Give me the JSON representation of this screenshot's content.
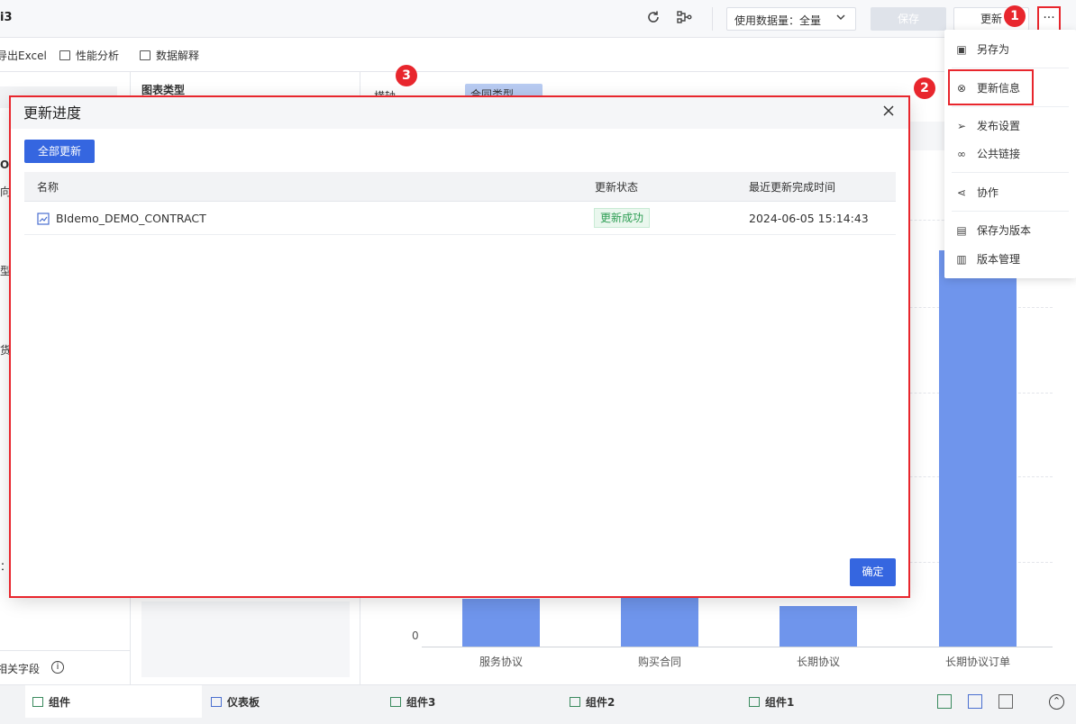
{
  "header": {
    "title": "i3",
    "data_select_label": "使用数据量：全量",
    "save_label": "保存",
    "update_label": "更新",
    "more_label": "···"
  },
  "toolbar": {
    "items": [
      "导出Excel",
      "性能分析",
      "数据解释"
    ]
  },
  "left_panel": {
    "fragments": [
      "O",
      "向",
      "型",
      "货",
      "：",
      "相关字段"
    ]
  },
  "mid_panel": {
    "title": "图表类型"
  },
  "chart_header": {
    "axis_label": "横轴",
    "field_chip": "合同类型"
  },
  "chart_data": {
    "type": "bar",
    "categories": [
      "服务协议",
      "购买合同",
      "长期协议",
      "长期协议订单"
    ],
    "values": [
      3.3,
      8.0,
      2.8,
      37.0
    ],
    "ytick_labels": [
      "0"
    ],
    "ylim": [
      0,
      40
    ],
    "bar_color": "#6f95ec"
  },
  "menu": {
    "items": [
      "另存为",
      "更新信息",
      "发布设置",
      "公共链接",
      "协作",
      "保存为版本",
      "版本管理"
    ],
    "highlighted": "更新信息"
  },
  "annotations": {
    "badges": [
      "1",
      "2",
      "3"
    ]
  },
  "dialog": {
    "title": "更新进度",
    "update_all_label": "全部更新",
    "columns": [
      "名称",
      "更新状态",
      "最近更新完成时间"
    ],
    "rows": [
      {
        "name": "BIdemo_DEMO_CONTRACT",
        "status": "更新成功",
        "time": "2024-06-05 15:14:43"
      }
    ],
    "confirm_label": "确定"
  },
  "bottom_tabs": {
    "items": [
      "组件",
      "仪表板",
      "组件3",
      "组件2",
      "组件1"
    ],
    "active": "组件"
  },
  "colors": {
    "accent": "#3566e0",
    "highlight_red": "#e8262d",
    "success_green": "#2e9e54"
  }
}
